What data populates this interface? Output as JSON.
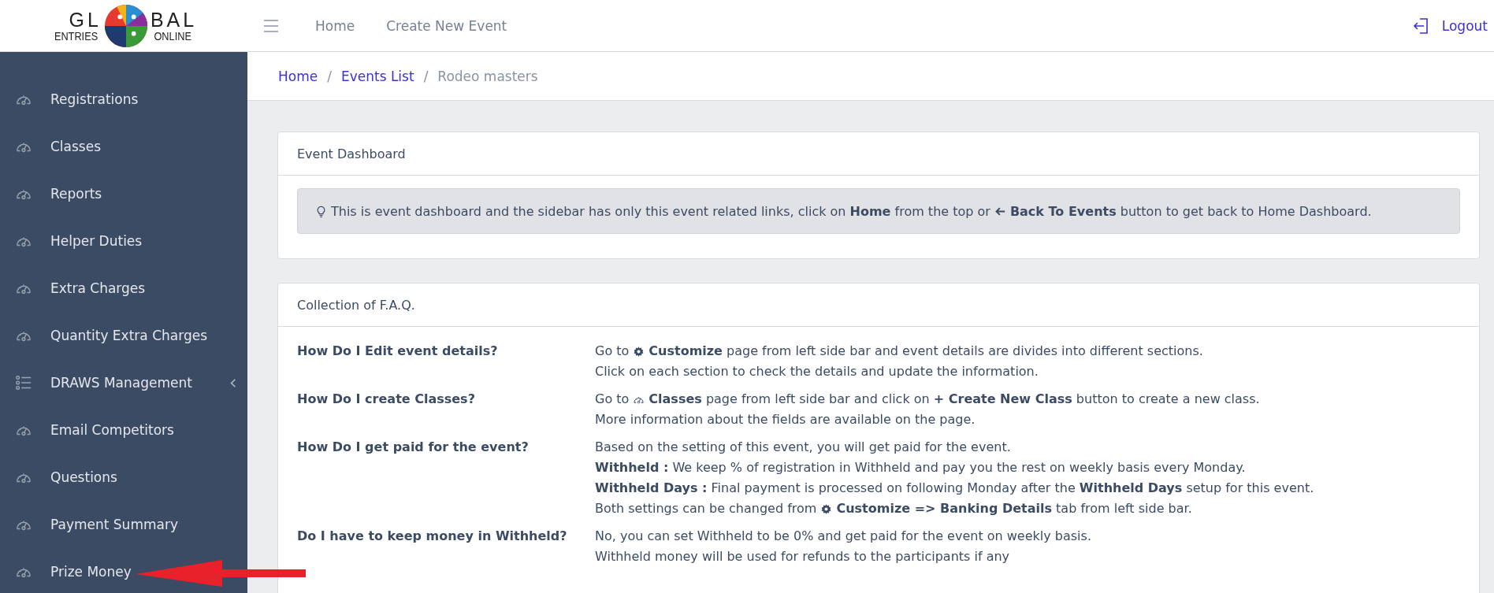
{
  "logo": {
    "top_left": "GL",
    "top_right": "BAL",
    "bottom_left": "ENTRIES",
    "bottom_right": "ONLINE"
  },
  "header": {
    "nav": [
      "Home",
      "Create New Event"
    ],
    "logout": "Logout"
  },
  "sidebar": {
    "items": [
      {
        "label": "Registrations",
        "kind": "link"
      },
      {
        "label": "Classes",
        "kind": "link"
      },
      {
        "label": "Reports",
        "kind": "link"
      },
      {
        "label": "Helper Duties",
        "kind": "link"
      },
      {
        "label": "Extra Charges",
        "kind": "link"
      },
      {
        "label": "Quantity Extra Charges",
        "kind": "link"
      },
      {
        "label": "DRAWS Management",
        "kind": "group"
      },
      {
        "label": "Email Competitors",
        "kind": "link"
      },
      {
        "label": "Questions",
        "kind": "link"
      },
      {
        "label": "Payment Summary",
        "kind": "link"
      },
      {
        "label": "Prize Money",
        "kind": "link"
      }
    ]
  },
  "breadcrumb": {
    "separator": "/",
    "items": [
      {
        "label": "Home",
        "kind": "link"
      },
      {
        "label": "Events List",
        "kind": "link"
      },
      {
        "label": "Rodeo masters",
        "kind": "current"
      }
    ]
  },
  "dashboard_card": {
    "title": "Event Dashboard",
    "alert": [
      {
        "kind": "bulb"
      },
      {
        "kind": "text",
        "text": "This is event dashboard and the sidebar has only this event related links, click on **Home** from the top or"
      },
      {
        "kind": "arrow"
      },
      {
        "kind": "text",
        "text": "**Back To Events** button to get back to Home Dashboard."
      }
    ]
  },
  "faq_card": {
    "title": "Collection of F.A.Q.",
    "items": [
      {
        "question": "How Do I Edit event details?",
        "lines": [
          [
            {
              "kind": "text",
              "text": "Go to"
            },
            {
              "kind": "gear"
            },
            {
              "kind": "text",
              "text": "**Customize** page from left side bar and event details are divides into different sections."
            }
          ],
          [
            {
              "kind": "text",
              "text": "Click on each section to check the details and update the information."
            }
          ]
        ]
      },
      {
        "question": "How Do I create Classes?",
        "lines": [
          [
            {
              "kind": "text",
              "text": "Go to"
            },
            {
              "kind": "gauge"
            },
            {
              "kind": "text",
              "text": "**Classes** page from left side bar and click on **+ Create New Class** button to create a new class."
            }
          ],
          [
            {
              "kind": "text",
              "text": "More information about the fields are available on the page."
            }
          ]
        ]
      },
      {
        "question": "How Do I get paid for the event?",
        "lines": [
          [
            {
              "kind": "text",
              "text": "Based on the setting of this event, you will get paid for the event."
            }
          ],
          [
            {
              "kind": "text",
              "text": "**Withheld :** We keep % of registration in Withheld and pay you the rest on weekly basis every Monday."
            }
          ],
          [
            {
              "kind": "text",
              "text": "**Withheld Days :** Final payment is processed on following Monday after the **Withheld Days** setup for this event."
            }
          ],
          [
            {
              "kind": "text",
              "text": "Both settings can be changed from"
            },
            {
              "kind": "gear"
            },
            {
              "kind": "text",
              "text": "**Customize => Banking Details** tab from left side bar."
            }
          ]
        ]
      },
      {
        "question": "Do I have to keep money in Withheld?",
        "lines": [
          [
            {
              "kind": "text",
              "text": "No, you can set Withheld to be 0% and get paid for the event on weekly basis."
            }
          ],
          [
            {
              "kind": "text",
              "text": "Withheld money will be used for refunds to the participants if any"
            }
          ]
        ]
      }
    ]
  },
  "annotation": {
    "kind": "arrow"
  }
}
